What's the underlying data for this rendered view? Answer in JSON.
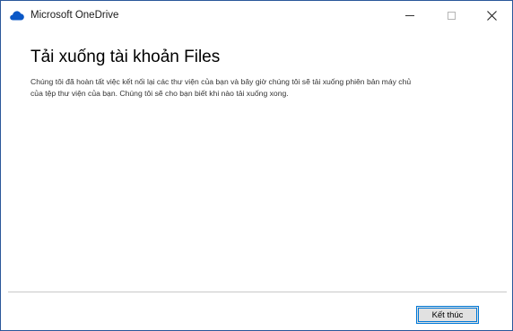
{
  "window": {
    "title": "Microsoft OneDrive",
    "app_icon": "onedrive-cloud-icon",
    "controls": {
      "minimize": "minimize-icon",
      "maximize": "maximize-icon",
      "close": "close-icon"
    }
  },
  "content": {
    "heading": "Tải xuống tài khoản Files",
    "description": "Chúng tôi đã hoàn tất việc kết nối lại các thư viện của bạn và bây giờ chúng tôi sẽ tải xuống phiên bản máy chủ của tệp thư viện của bạn. Chúng tôi sẽ cho bạn biết khi nào tải xuống xong."
  },
  "footer": {
    "finish_label": "Kết thúc"
  },
  "colors": {
    "border": "#2b579a",
    "accent": "#0078d7",
    "onedrive_blue": "#0a57c6",
    "button_bg": "#e1e1e1"
  }
}
